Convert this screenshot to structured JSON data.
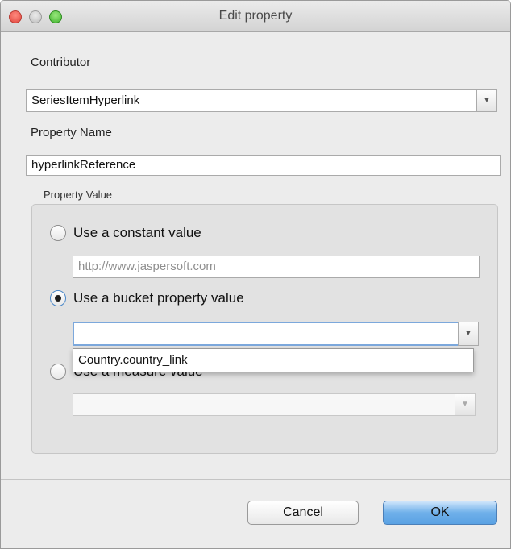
{
  "window": {
    "title": "Edit property"
  },
  "contributor": {
    "label": "Contributor",
    "value": "SeriesItemHyperlink",
    "arrow": "▼"
  },
  "property_name": {
    "label": "Property Name",
    "value": "hyperlinkReference"
  },
  "property_value": {
    "legend": "Property Value",
    "constant": {
      "label": "Use a constant value",
      "placeholder": "http://www.jaspersoft.com",
      "selected": false
    },
    "bucket": {
      "label": "Use a bucket property value",
      "value": "",
      "selected": true,
      "arrow": "▼"
    },
    "measure": {
      "label": "Use a measure value",
      "value": "",
      "selected": false,
      "arrow": "▼"
    },
    "dropdown_options": [
      "Country.country_link"
    ]
  },
  "buttons": {
    "cancel": "Cancel",
    "ok": "OK"
  }
}
